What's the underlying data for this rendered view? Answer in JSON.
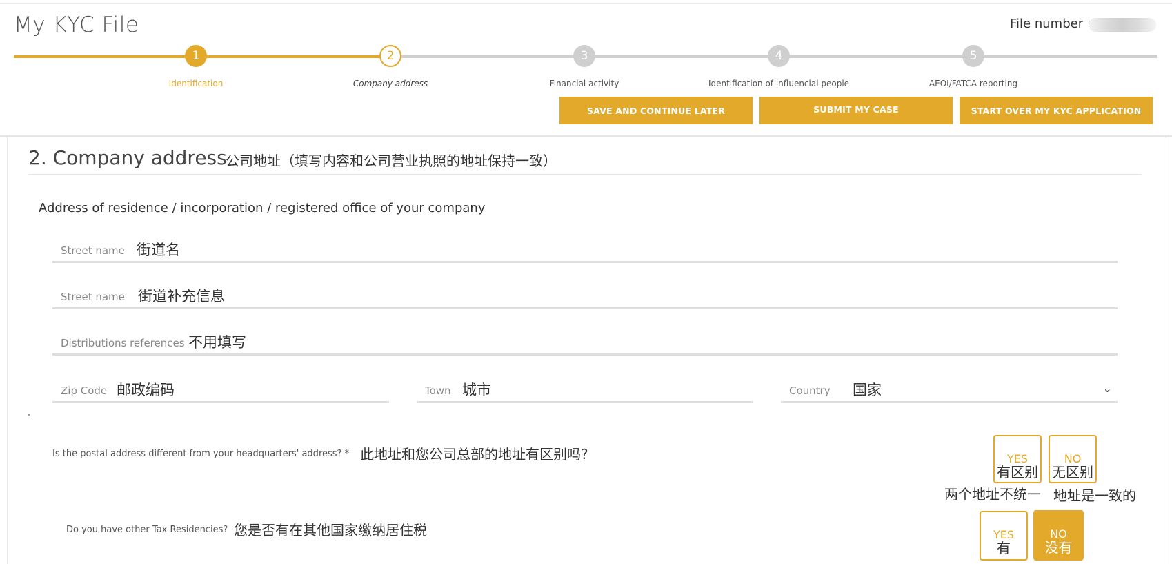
{
  "header": {
    "title": "My KYC File",
    "file_number_label": "File number :"
  },
  "steps": [
    {
      "number": "1",
      "label": "Identification",
      "state": "done"
    },
    {
      "number": "2",
      "label": "Company address",
      "state": "current"
    },
    {
      "number": "3",
      "label": "Financial activity",
      "state": "todo"
    },
    {
      "number": "4",
      "label": "Identification of influencial people",
      "state": "todo"
    },
    {
      "number": "5",
      "label": "AEOI/FATCA reporting",
      "state": "todo"
    }
  ],
  "actions": {
    "save_later": "SAVE AND CONTINUE LATER",
    "submit": "SUBMIT MY CASE",
    "start_over": "START OVER MY KYC APPLICATION"
  },
  "section": {
    "title": "2. Company address",
    "note": "公司地址（填写内容和公司营业执照的地址保持一致）",
    "subtitle": "Address of residence / incorporation / registered office of your company"
  },
  "fields": {
    "street1": {
      "label": "Street name",
      "value": "街道名"
    },
    "street2": {
      "label": "Street name",
      "value": "街道补充信息"
    },
    "distribution": {
      "label": "Distributions references",
      "value": "不用填写"
    },
    "zip": {
      "label": "Zip Code",
      "value": "邮政编码"
    },
    "town": {
      "label": "Town",
      "value": "城市"
    },
    "country": {
      "label": "Country",
      "value": "国家"
    }
  },
  "questions": {
    "postal": {
      "label": "Is the postal address different from your headquarters' address? *",
      "note": "此地址和您公司总部的地址有区别吗?",
      "yes_en": "YES",
      "yes_cn": "有区别",
      "yes_note": "两个地址不统一",
      "no_en": "NO",
      "no_cn": "无区别",
      "no_note": "地址是一致的"
    },
    "tax": {
      "label": "Do you have other Tax Residencies?",
      "note": "您是否有在其他国家缴纳居住税",
      "yes_en": "YES",
      "yes_cn": "有",
      "no_en": "NO",
      "no_cn": "没有",
      "selected": "NO"
    }
  },
  "colors": {
    "accent": "#e2a92a",
    "inactive": "#cfcfcf"
  }
}
